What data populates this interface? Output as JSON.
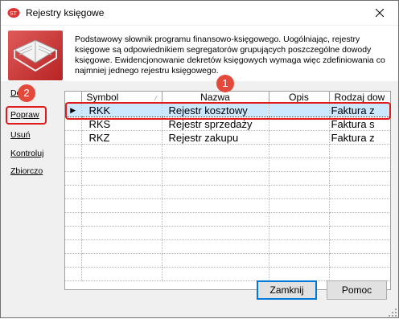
{
  "window": {
    "title": "Rejestry księgowe"
  },
  "description": "Podstawowy słownik programu finansowo-księgowego. Uogólniając, rejestry księgowe są odpowiednikiem segregatorów grupujących poszczególne dowody księgowe. Ewidencjonowanie dekretów księgowych wymaga więc zdefiniowania co najmniej jednego rejestru księgowego.",
  "sidebar": {
    "items": [
      {
        "label": "Dodaj"
      },
      {
        "label": "Popraw"
      },
      {
        "label": "Usuń"
      },
      {
        "label": "Kontroluj"
      },
      {
        "label": "Zbiorczo"
      }
    ]
  },
  "table": {
    "columns": [
      "Symbol",
      "Nazwa",
      "Opis",
      "Rodzaj dow"
    ],
    "rows": [
      {
        "symbol": "RKK",
        "nazwa": "Rejestr kosztowy",
        "opis": "",
        "rodzaj": "Faktura z"
      },
      {
        "symbol": "RKS",
        "nazwa": "Rejestr sprzedaży",
        "opis": "",
        "rodzaj": "Faktura s"
      },
      {
        "symbol": "RKZ",
        "nazwa": "Rejestr zakupu",
        "opis": "",
        "rodzaj": "Faktura z"
      }
    ],
    "selected_row": 0
  },
  "buttons": {
    "close_label": "Zamknij",
    "help_label": "Pomoc"
  },
  "annotations": [
    {
      "number": "1"
    },
    {
      "number": "2"
    }
  ],
  "colors": {
    "accent": "#e01b1b",
    "selection": "#cce8ff",
    "badge": "#e34a3b"
  }
}
